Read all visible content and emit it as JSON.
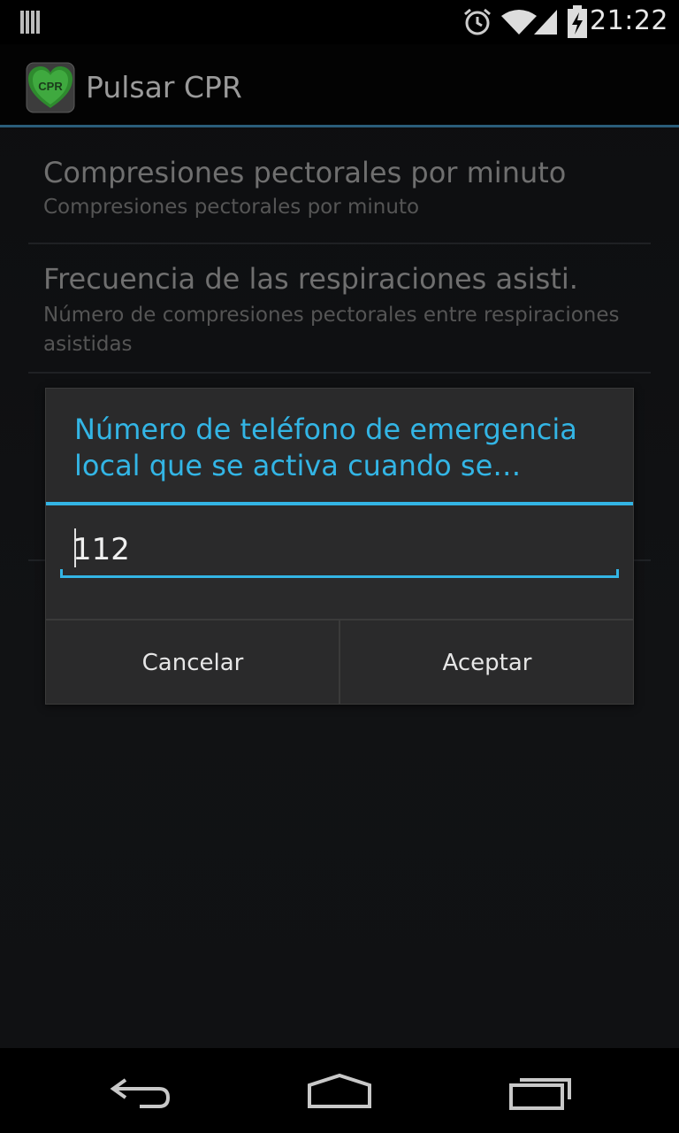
{
  "status_bar": {
    "time": "21:22",
    "icons": [
      "notification-bars-icon",
      "alarm-icon",
      "wifi-icon",
      "signal-icon",
      "battery-charging-icon"
    ]
  },
  "action_bar": {
    "title": "Pulsar CPR",
    "icon_text": "CPR"
  },
  "preferences": [
    {
      "title": "Compresiones pectorales por minuto",
      "summary": "Compresiones pectorales por minuto"
    },
    {
      "title": "Frecuencia de las respiraciones asisti.",
      "summary": "Número de compresiones pectorales entre respiraciones asistidas"
    }
  ],
  "dialog": {
    "title": "Número de teléfono de emergencia local que se activa cuando se…",
    "input_value": "112",
    "cancel_label": "Cancelar",
    "accept_label": "Aceptar"
  },
  "nav_bar": {
    "icons": [
      "back-icon",
      "home-icon",
      "recents-icon"
    ]
  },
  "colors": {
    "accent": "#33b5e5",
    "dialog_bg": "#2a2a2b",
    "background": "#111214"
  }
}
